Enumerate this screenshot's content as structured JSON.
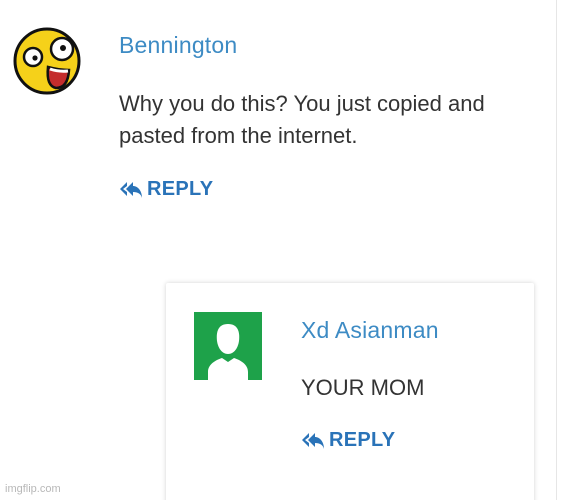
{
  "comments": [
    {
      "author": "Bennington",
      "text": "Why you do this? You just copied and pasted from the internet.",
      "reply_label": "REPLY",
      "avatar_icon": "shocked-face-icon"
    },
    {
      "author": "Xd Asianman",
      "text": "YOUR MOM",
      "reply_label": "REPLY",
      "avatar_icon": "default-user-icon"
    }
  ],
  "colors": {
    "author": "#3d8bc4",
    "reply": "#2a73b8",
    "text": "#333333",
    "avatar_green": "#1ea24a",
    "face_yellow": "#f5d11a"
  },
  "watermark": "imgflip.com"
}
